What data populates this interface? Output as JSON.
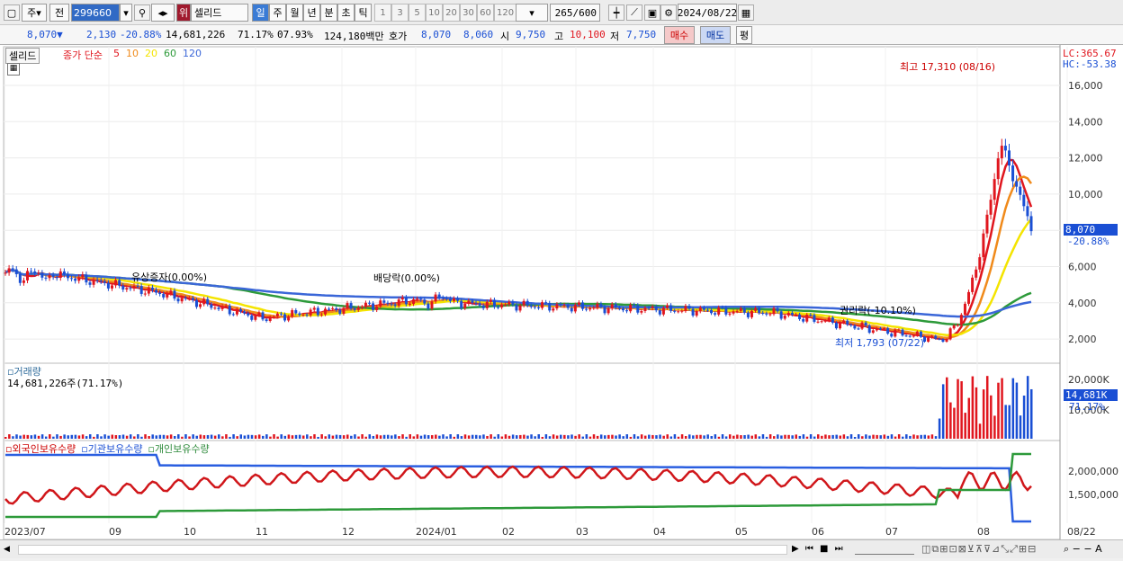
{
  "toolbar": {
    "market": "주",
    "prev_button": "전",
    "code": "299660",
    "stock_name": "셀리드",
    "name_prefix": "위",
    "periods": [
      "일",
      "주",
      "월",
      "년",
      "분",
      "초",
      "틱"
    ],
    "intervals": [
      "1",
      "3",
      "5",
      "10",
      "20",
      "30",
      "60",
      "120"
    ],
    "count": "265",
    "count_total": "/600",
    "date": "2024/08/22"
  },
  "quote": {
    "price": "8,070",
    "change": "2,130",
    "change_pct": "-20.88%",
    "volume": "14,681,226",
    "vol_ratio": "71.17%",
    "turnover": "07.93%",
    "amount": "124,180백만",
    "bid_label": "호가",
    "ask": "8,070",
    "bid": "8,060",
    "open_label": "시",
    "open": "9,750",
    "high_label": "고",
    "high": "10,100",
    "low_label": "저",
    "low": "7,750",
    "buy_button": "매수",
    "sell_button": "매도",
    "eval_button": "평"
  },
  "price_panel": {
    "name_tag": "셀리드",
    "ma_label": "종가 단순",
    "ma_periods": [
      "5",
      "10",
      "20",
      "60",
      "120"
    ],
    "lc": "LC:365.67",
    "hc": "HC:-53.38",
    "last_price": "8,070",
    "last_pct": "-20.88%",
    "y_ticks": [
      "16,000",
      "14,000",
      "12,000",
      "10,000",
      "8,000",
      "6,000",
      "4,000",
      "2,000"
    ],
    "annotations": {
      "high": "최고 17,310 (08/16)",
      "low": "최저 1,793 (07/22)",
      "rights": "유상증자(0.00%)",
      "dividend": "배당락(0.00%)",
      "ex_rights": "권리락(-10.10%)"
    }
  },
  "volume_panel": {
    "title": "거래량",
    "value": "14,681,226주(71.17%)",
    "y_ticks": [
      "20,000K",
      "10,000K"
    ],
    "last": "14,681K",
    "last_pct": "71.17%"
  },
  "holder_panel": {
    "labels": [
      "외국인보유수량",
      "기관보유수량",
      "개인보유수량"
    ],
    "y_ticks": [
      "2,000,000",
      "1,500,000"
    ]
  },
  "x_ticks": [
    "2023/07",
    "09",
    "10",
    "11",
    "12",
    "2024/01",
    "02",
    "03",
    "04",
    "05",
    "06",
    "07",
    "08",
    "08/22"
  ],
  "colors": {
    "up": "#e0161e",
    "down": "#1a4fd4",
    "ma5": "#e0161e",
    "ma10": "#f08a1a",
    "ma20": "#f4e400",
    "ma60": "#2d9a3a",
    "ma120": "#3a66d8"
  }
}
